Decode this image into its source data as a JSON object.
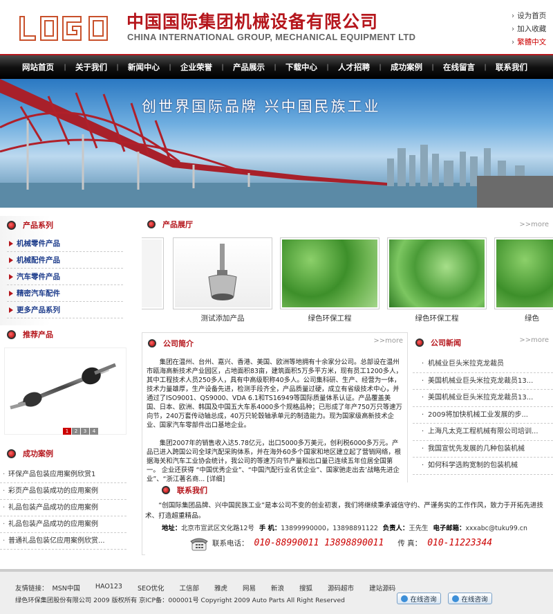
{
  "header": {
    "company_cn": "中国国际集团机械设备有限公司",
    "company_en": "CHINA INTERNATIONAL GROUP, MECHANICAL EQUIPMENT LTD",
    "links": [
      "设为首页",
      "加入收藏",
      "繁體中文"
    ]
  },
  "nav": [
    "网站首页",
    "关于我们",
    "新闻中心",
    "企业荣誉",
    "产品展示",
    "下载中心",
    "人才招聘",
    "成功案例",
    "在线留言",
    "联系我们"
  ],
  "banner": {
    "slogan": "创世界国际品牌    兴中国民族工业"
  },
  "sidebar": {
    "category_title": "产品系列",
    "categories": [
      "机械零件产品",
      "机械配件产品",
      "汽车零件产品",
      "精密汽车配件",
      "更多产品系列"
    ],
    "recommend_title": "推荐产品",
    "pager": [
      "1",
      "2",
      "3",
      "4"
    ],
    "cases_title": "成功案例",
    "cases": [
      "环保产品包装应用案例欣赏1",
      "彩页产品包装成功的应用案例",
      "礼品包装产品成功的应用案例",
      "礼品包装产品成功的应用案例",
      "普通礼品包装亿应用案例欣赏..."
    ]
  },
  "products": {
    "title": "产品展厅",
    "more": ">>more",
    "items": [
      "测试添加产品",
      "绿色环保工程",
      "绿色环保工程",
      "绿色"
    ]
  },
  "intro": {
    "title": "公司简介",
    "more": ">>more",
    "p1": "集团在温州、台州、嘉兴、香港、美国、欧洲等地拥有十余家分公司。总部设在温州市瓯海高新技术产业园区，占地面积83亩，建筑面积5万多平方米，现有员工1200多人，其中工程技术人员250多人，具有中高级职称40多人。公司集科研、生产、经营为一体，技术力量雄厚，生产设备先进，检测手段齐全，产品质量过硬，成立有省级技术中心，并通过了ISO9001、QS9000、VDA 6.1和TS16949等国际质量体系认证。产品覆盖美国、日本、欧洲、韩国及中国五大车系4000多个规格品种；已形成了年产750万只等速万向节，240万套传动轴总成，40万只轮毂轴承单元的制造能力。现为国家级高新技术企业、国家汽车零部件出口基地企业。",
    "p2": "集团2007年的销售收入达5.78亿元，出口5000多万美元，创利税6000多万元。产品已进入跨国公司全球汽配采购体系，并在海外60多个国家和地区建立起了营销网络，根据海关和汽车工业协会统计，我公司的等速万向节产量和出口量已连续五年位居全国第一。 企业还获得 “中国优秀企业”、“中国汽配行业名优企业”、国家驰走出去’战略先进企业”、“浙江著名商...",
    "detail": "[详细]"
  },
  "news": {
    "title": "公司新闻",
    "more": ">>more",
    "items": [
      "机械业巨头米拉克龙裁员",
      "美国机械业巨头米拉克龙裁员13...",
      "美国机械业巨头米拉克龙裁员13...",
      "2009将加快机械工业发展的步...",
      "上海凡太克工程机械有限公司培训...",
      "我国宣忧先发展的几种包装机械",
      "如何科学选购宽制的包装机械"
    ]
  },
  "contact": {
    "title": "联系我们",
    "text": "“创国际集团品牌、兴中国民族工业”是本公司不变的创业初衷，我们将继续秉承诚信守约、严谨务实的工作作风，致力于开拓先进技术、打造超重精品。",
    "addr_label": "地址：",
    "addr": "北京市宣武区文化路12号",
    "mobile_label": "手 机：",
    "mobile": "13899990000，13898891122",
    "person_label": "负责人：",
    "person": "王先生",
    "email_label": "电子邮箱：",
    "email": "xxxabc@tuku99.cn",
    "tel_label": "联系电话：",
    "tel": "010-88990011  13898890011",
    "fax_label": "传 真：",
    "fax": "010-11223344"
  },
  "footer": {
    "links_label": "友情链接：",
    "links": [
      "MSN中国",
      "HAO123",
      "SEO优化",
      "工信部",
      "雅虎",
      "网易",
      "新浪",
      "搜狐",
      "源码超市",
      "建站源码"
    ],
    "copyright": "绿色环保集团股份有限公司 2009 版权所有 京ICP备：000001号 Copyright 2009 Auto Parts All Right Reserved",
    "consult": [
      "在线咨询",
      "在线咨询"
    ]
  },
  "colors": {
    "brand_red": "#b5161c",
    "nav_bg": "#111111",
    "link_blue": "#1e3d8c"
  }
}
